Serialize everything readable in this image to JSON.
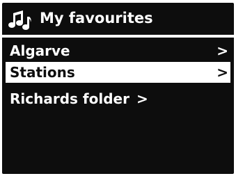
{
  "header": {
    "title": "My favourites",
    "icon": "music-notes-icon"
  },
  "menu": {
    "items": [
      {
        "label": "Algarve",
        "arrow": ">",
        "selected": false
      },
      {
        "label": "Stations",
        "arrow": ">",
        "selected": true
      },
      {
        "label": "Richards folder",
        "arrow": ">",
        "selected": false
      }
    ]
  },
  "colors": {
    "screen_background": "#0d0d0d",
    "text": "#ffffff",
    "highlight_background": "#ffffff",
    "highlight_text": "#0d0d0d"
  }
}
